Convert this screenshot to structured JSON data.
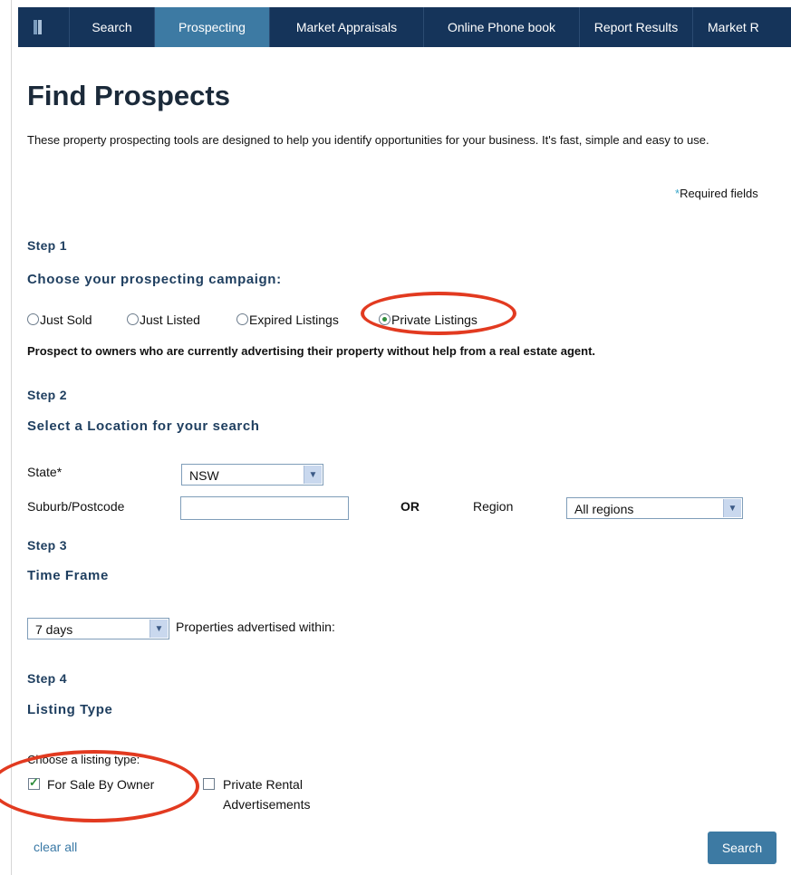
{
  "nav": {
    "items": [
      "Search",
      "Prospecting",
      "Market Appraisals",
      "Online Phone book",
      "Report Results",
      "Market R"
    ],
    "active_index": 1
  },
  "page": {
    "title": "Find Prospects",
    "intro": "These property prospecting tools are designed to help you identify opportunities for your business. It's fast, simple and easy to use.",
    "required_star": "*",
    "required_label": "Required fields"
  },
  "step1": {
    "label": "Step 1",
    "heading": "Choose your prospecting campaign:",
    "options": [
      "Just Sold",
      "Just Listed",
      "Expired Listings",
      "Private Listings"
    ],
    "selected": "Private Listings",
    "description": "Prospect to owners who are currently advertising their property without help from a real estate agent."
  },
  "step2": {
    "label": "Step 2",
    "heading": "Select a Location for your search",
    "state_label": "State*",
    "state_value": "NSW",
    "suburb_label": "Suburb/Postcode",
    "suburb_value": "",
    "or_label": "OR",
    "region_label": "Region",
    "region_value": "All regions"
  },
  "step3": {
    "label": "Step 3",
    "heading": "Time Frame",
    "timeframe_value": "7 days",
    "timeframe_label": "Properties advertised within:"
  },
  "step4": {
    "label": "Step 4",
    "heading": "Listing Type",
    "choose_label": "Choose a listing type:",
    "fsbo_label": "For Sale By Owner",
    "fsbo_checked": true,
    "rental_label_line1": "Private Rental",
    "rental_label_line2": "Advertisements",
    "rental_checked": false
  },
  "actions": {
    "clear_label": "clear all",
    "search_label": "Search"
  },
  "colors": {
    "nav_bg": "#15345a",
    "nav_active": "#3d7aa3",
    "heading": "#1e3e5f",
    "annotation": "#e23a20"
  }
}
